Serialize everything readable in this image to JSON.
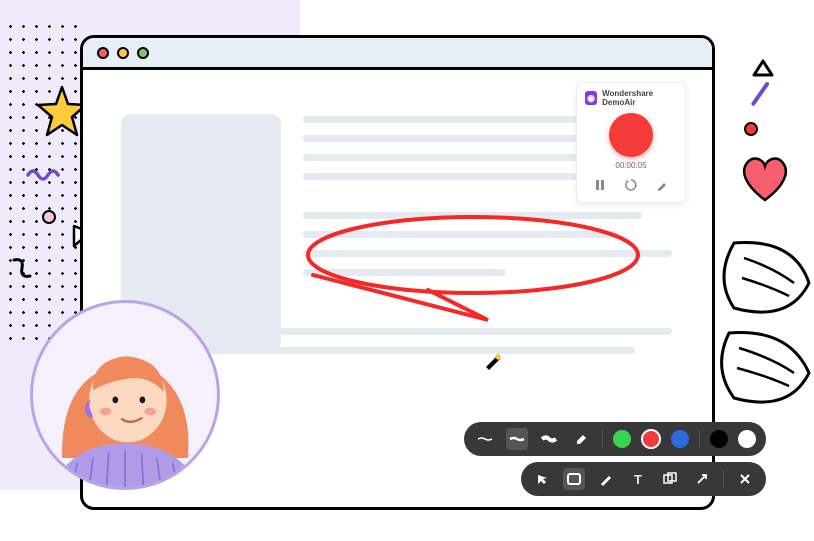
{
  "app": {
    "name": "Wondershare DemoAir",
    "timer": "00:00:05"
  },
  "rec_controls": {
    "pause": "pause",
    "restart": "restart",
    "draw": "draw"
  },
  "toolbar_top": {
    "line_thin": "thin-line",
    "line_med": "medium-line",
    "line_thick": "thick-line",
    "eraser": "eraser",
    "colors": [
      "green",
      "red",
      "blue",
      "black",
      "white"
    ]
  },
  "toolbar_bottom": {
    "select": "select",
    "rect": "rectangle",
    "pen": "pen",
    "text_label": "T",
    "shape": "shape",
    "arrow": "arrow",
    "close": "close"
  }
}
